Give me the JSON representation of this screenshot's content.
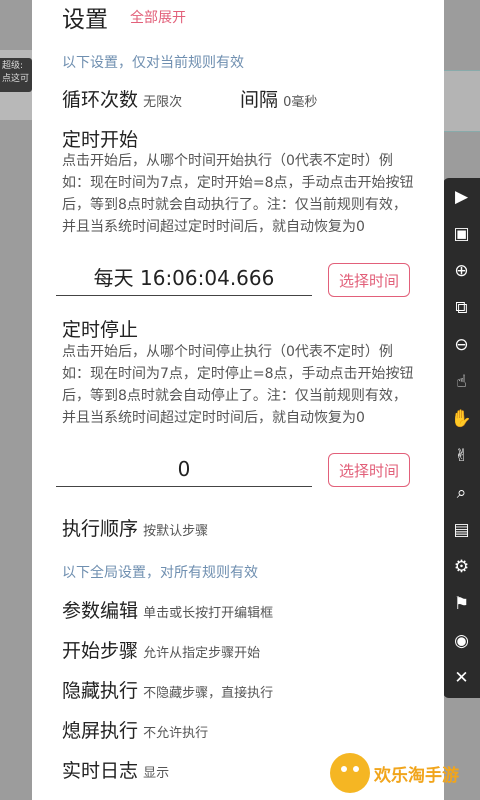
{
  "background": {
    "chip_text_1": "超级:",
    "chip_text_2": "点这可",
    "toolbar_icons": [
      "play-icon",
      "camera-icon",
      "plus-icon",
      "copy-icon",
      "minus-icon",
      "tap-icon",
      "long-press-icon",
      "swipe-icon",
      "search-icon",
      "doc-icon",
      "gear-icon",
      "flag-icon",
      "eye-icon",
      "close-icon",
      "collapse-icon"
    ]
  },
  "dialog": {
    "title": "设置",
    "expand_all": "全部展开",
    "section_current": "以下设置，仅对当前规则有效",
    "loop": {
      "label": "循环次数",
      "value": "无限次"
    },
    "interval": {
      "label": "间隔",
      "value": "0毫秒"
    },
    "timer_start": {
      "label": "定时开始",
      "desc": "点击开始后，从哪个时间开始执行（0代表不定时）例如：现在时间为7点，定时开始=8点，手动点击开始按钮后，等到8点时就会自动执行了。注：仅当前规则有效，并且当系统时间超过定时时间后，就自动恢复为0",
      "value": "每天 16:06:04.666",
      "button": "选择时间"
    },
    "timer_stop": {
      "label": "定时停止",
      "desc": "点击开始后，从哪个时间停止执行（0代表不定时）例如：现在时间为7点，定时停止=8点，手动点击开始按钮后，等到8点时就会自动停止了。注：仅当前规则有效，并且当系统时间超过定时时间后，就自动恢复为0",
      "value": "0",
      "button": "选择时间"
    },
    "order": {
      "label": "执行顺序",
      "value": "按默认步骤"
    },
    "section_global": "以下全局设置，对所有规则有效",
    "param_edit": {
      "label": "参数编辑",
      "value": "单击或长按打开编辑框"
    },
    "start_step": {
      "label": "开始步骤",
      "value": "允许从指定步骤开始"
    },
    "hide_exec": {
      "label": "隐藏执行",
      "value": "不隐藏步骤，直接执行"
    },
    "screen_off": {
      "label": "熄屏执行",
      "value": "不允许执行"
    },
    "realtime_log": {
      "label": "实时日志",
      "value": "显示"
    }
  },
  "watermark": {
    "text": "欢乐淘手游"
  }
}
